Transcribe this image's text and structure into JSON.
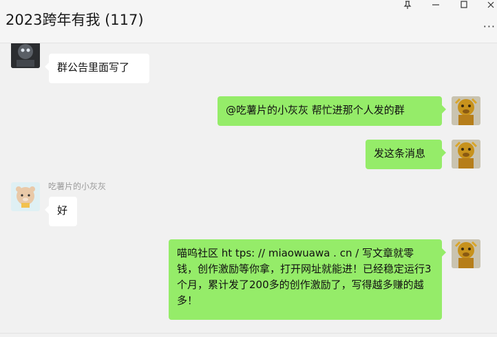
{
  "window": {
    "title": "2023跨年有我 (117)",
    "pin_glyph": "⊥",
    "minimize_glyph": "—",
    "maximize_glyph": "☐",
    "close_glyph": "✕",
    "more_glyph": "···"
  },
  "messages": [
    {
      "direction": "incoming",
      "sender": "",
      "text": "群公告里面写了",
      "avatar_icon": "dark-cartoon-avatar"
    },
    {
      "direction": "outgoing",
      "text": "@吃薯片的小灰灰 帮忙进那个人发的群",
      "avatar_icon": "golden-monkey-avatar"
    },
    {
      "direction": "outgoing",
      "text": "发这条消息",
      "avatar_icon": "golden-monkey-avatar"
    },
    {
      "direction": "incoming",
      "sender": "吃薯片的小灰灰",
      "text": "好",
      "avatar_icon": "cartoon-bear-avatar"
    },
    {
      "direction": "outgoing",
      "text": "喵呜社区 ht tps: // miaowuawa . cn / 写文章就零钱，创作激励等你拿，打开网址就能进！已经稳定运行3个月，累计发了200多的创作激励了，写得越多赚的越多！",
      "avatar_icon": "golden-monkey-avatar"
    }
  ],
  "colors": {
    "background": "#f1f1f1",
    "outgoing_bubble": "#95ec69",
    "incoming_bubble": "#ffffff",
    "sender_name": "#9a9a9a"
  }
}
